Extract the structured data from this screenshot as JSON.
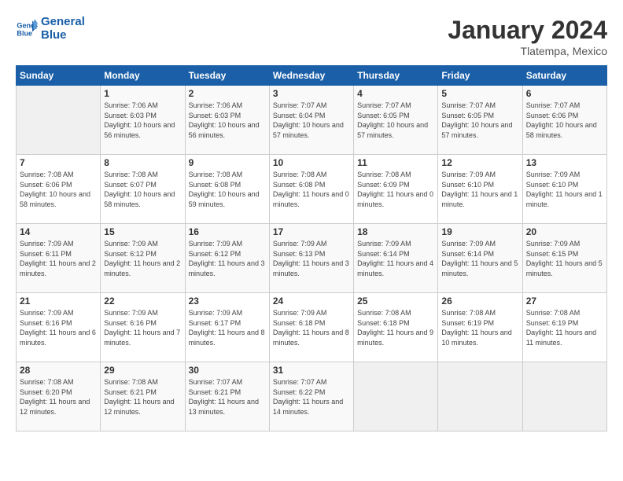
{
  "header": {
    "logo": {
      "line1": "General",
      "line2": "Blue"
    },
    "title": "January 2024",
    "location": "Tlatempa, Mexico"
  },
  "weekdays": [
    "Sunday",
    "Monday",
    "Tuesday",
    "Wednesday",
    "Thursday",
    "Friday",
    "Saturday"
  ],
  "weeks": [
    [
      {
        "num": "",
        "empty": true
      },
      {
        "num": "1",
        "sunrise": "7:06 AM",
        "sunset": "6:03 PM",
        "daylight": "10 hours and 56 minutes."
      },
      {
        "num": "2",
        "sunrise": "7:06 AM",
        "sunset": "6:03 PM",
        "daylight": "10 hours and 56 minutes."
      },
      {
        "num": "3",
        "sunrise": "7:07 AM",
        "sunset": "6:04 PM",
        "daylight": "10 hours and 57 minutes."
      },
      {
        "num": "4",
        "sunrise": "7:07 AM",
        "sunset": "6:05 PM",
        "daylight": "10 hours and 57 minutes."
      },
      {
        "num": "5",
        "sunrise": "7:07 AM",
        "sunset": "6:05 PM",
        "daylight": "10 hours and 57 minutes."
      },
      {
        "num": "6",
        "sunrise": "7:07 AM",
        "sunset": "6:06 PM",
        "daylight": "10 hours and 58 minutes."
      }
    ],
    [
      {
        "num": "7",
        "sunrise": "7:08 AM",
        "sunset": "6:06 PM",
        "daylight": "10 hours and 58 minutes."
      },
      {
        "num": "8",
        "sunrise": "7:08 AM",
        "sunset": "6:07 PM",
        "daylight": "10 hours and 58 minutes."
      },
      {
        "num": "9",
        "sunrise": "7:08 AM",
        "sunset": "6:08 PM",
        "daylight": "10 hours and 59 minutes."
      },
      {
        "num": "10",
        "sunrise": "7:08 AM",
        "sunset": "6:08 PM",
        "daylight": "11 hours and 0 minutes."
      },
      {
        "num": "11",
        "sunrise": "7:08 AM",
        "sunset": "6:09 PM",
        "daylight": "11 hours and 0 minutes."
      },
      {
        "num": "12",
        "sunrise": "7:09 AM",
        "sunset": "6:10 PM",
        "daylight": "11 hours and 1 minute."
      },
      {
        "num": "13",
        "sunrise": "7:09 AM",
        "sunset": "6:10 PM",
        "daylight": "11 hours and 1 minute."
      }
    ],
    [
      {
        "num": "14",
        "sunrise": "7:09 AM",
        "sunset": "6:11 PM",
        "daylight": "11 hours and 2 minutes."
      },
      {
        "num": "15",
        "sunrise": "7:09 AM",
        "sunset": "6:12 PM",
        "daylight": "11 hours and 2 minutes."
      },
      {
        "num": "16",
        "sunrise": "7:09 AM",
        "sunset": "6:12 PM",
        "daylight": "11 hours and 3 minutes."
      },
      {
        "num": "17",
        "sunrise": "7:09 AM",
        "sunset": "6:13 PM",
        "daylight": "11 hours and 3 minutes."
      },
      {
        "num": "18",
        "sunrise": "7:09 AM",
        "sunset": "6:14 PM",
        "daylight": "11 hours and 4 minutes."
      },
      {
        "num": "19",
        "sunrise": "7:09 AM",
        "sunset": "6:14 PM",
        "daylight": "11 hours and 5 minutes."
      },
      {
        "num": "20",
        "sunrise": "7:09 AM",
        "sunset": "6:15 PM",
        "daylight": "11 hours and 5 minutes."
      }
    ],
    [
      {
        "num": "21",
        "sunrise": "7:09 AM",
        "sunset": "6:16 PM",
        "daylight": "11 hours and 6 minutes."
      },
      {
        "num": "22",
        "sunrise": "7:09 AM",
        "sunset": "6:16 PM",
        "daylight": "11 hours and 7 minutes."
      },
      {
        "num": "23",
        "sunrise": "7:09 AM",
        "sunset": "6:17 PM",
        "daylight": "11 hours and 8 minutes."
      },
      {
        "num": "24",
        "sunrise": "7:09 AM",
        "sunset": "6:18 PM",
        "daylight": "11 hours and 8 minutes."
      },
      {
        "num": "25",
        "sunrise": "7:08 AM",
        "sunset": "6:18 PM",
        "daylight": "11 hours and 9 minutes."
      },
      {
        "num": "26",
        "sunrise": "7:08 AM",
        "sunset": "6:19 PM",
        "daylight": "11 hours and 10 minutes."
      },
      {
        "num": "27",
        "sunrise": "7:08 AM",
        "sunset": "6:19 PM",
        "daylight": "11 hours and 11 minutes."
      }
    ],
    [
      {
        "num": "28",
        "sunrise": "7:08 AM",
        "sunset": "6:20 PM",
        "daylight": "11 hours and 12 minutes."
      },
      {
        "num": "29",
        "sunrise": "7:08 AM",
        "sunset": "6:21 PM",
        "daylight": "11 hours and 12 minutes."
      },
      {
        "num": "30",
        "sunrise": "7:07 AM",
        "sunset": "6:21 PM",
        "daylight": "11 hours and 13 minutes."
      },
      {
        "num": "31",
        "sunrise": "7:07 AM",
        "sunset": "6:22 PM",
        "daylight": "11 hours and 14 minutes."
      },
      {
        "num": "",
        "empty": true
      },
      {
        "num": "",
        "empty": true
      },
      {
        "num": "",
        "empty": true
      }
    ]
  ]
}
